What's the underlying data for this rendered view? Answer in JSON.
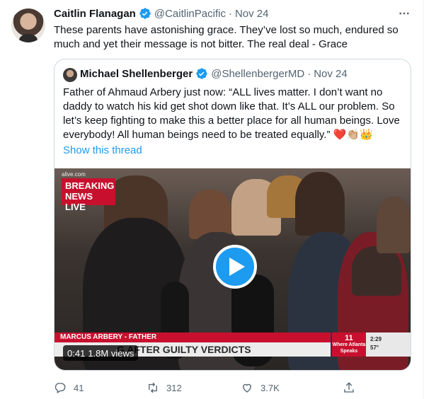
{
  "tweet": {
    "author_name": "Caitlin Flanagan",
    "author_handle": "@CaitlinPacific",
    "separator": "·",
    "time": "Nov 24",
    "text": "These parents have astonishing grace. They’ve lost so much, endured so much and yet their message is not bitter. The real deal - Grace"
  },
  "quote": {
    "author_name": "Michael Shellenberger",
    "author_handle": "@ShellenbergerMD",
    "separator": "·",
    "time": "Nov 24",
    "text": "Father of Ahmaud Arbery just now: “ALL lives matter. I don’t want no daddy to watch his kid get shot down like that. It’s ALL our problem. So let’s keep fighting to make this a better place for all human beings. Love everybody! All human beings need to be treated equally.”",
    "emoji": "❤️👏🏼👑",
    "show_thread": "Show this thread"
  },
  "video": {
    "url_overlay": "alive.com",
    "breaking_line1": "BREAKING",
    "breaking_line2": "NEWS LIVE",
    "lower_third_name": "MARCUS ARBERY - FATHER",
    "lower_third_text": "G AFTER GUILTY VERDICTS",
    "channel_tag": "Where Atlanta Speaks",
    "channel_logo": "11",
    "clock": "2:29",
    "temperature": "57°",
    "duration": "0:41",
    "views": "1.8M views"
  },
  "actions": {
    "replies": "41",
    "retweets": "312",
    "likes": "3.7K"
  },
  "colors": {
    "accent": "#1d9bf0",
    "muted": "#536471",
    "breaking_red": "#c8102e"
  },
  "icons": [
    "verified-icon",
    "more-icon",
    "play-icon",
    "reply-icon",
    "retweet-icon",
    "like-icon",
    "share-icon"
  ]
}
